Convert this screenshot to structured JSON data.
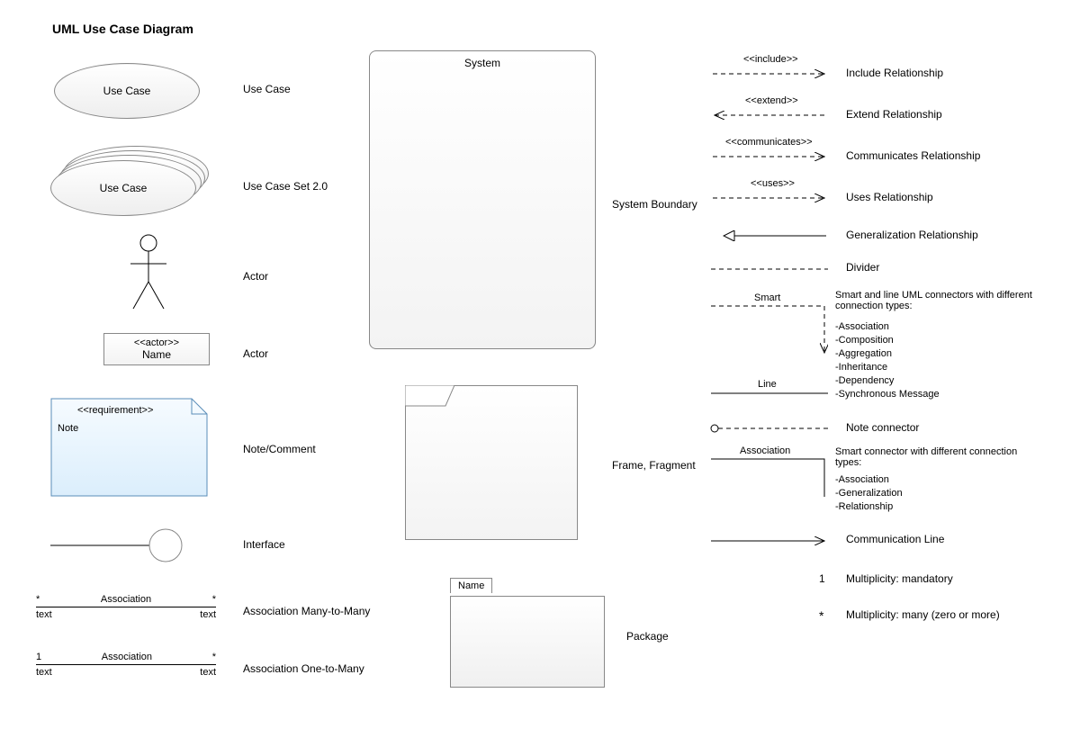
{
  "title": "UML Use Case Diagram",
  "left": {
    "useCase": {
      "shapeText": "Use Case",
      "label": "Use Case"
    },
    "useCaseSet": {
      "shapeText": "Use Case",
      "label": "Use Case Set 2.0"
    },
    "actorStick": {
      "label": "Actor"
    },
    "actorBox": {
      "stereo": "<<actor>>",
      "name": "Name",
      "label": "Actor"
    },
    "note": {
      "stereo": "<<requirement>>",
      "body": "Note",
      "label": "Note/Comment"
    },
    "interface": {
      "label": "Interface"
    },
    "assocMM": {
      "word": "Association",
      "starL": "*",
      "starR": "*",
      "textL": "text",
      "textR": "text",
      "label": "Association Many-to-Many"
    },
    "assocOM": {
      "word": "Association",
      "one": "1",
      "star": "*",
      "textL": "text",
      "textR": "text",
      "label": "Association One-to-Many"
    }
  },
  "center": {
    "system": {
      "title": "System",
      "label": "System Boundary"
    },
    "frame": {
      "label": "Frame, Fragment"
    },
    "package": {
      "name": "Name",
      "label": "Package"
    }
  },
  "right": {
    "include": {
      "text": "<<include>>",
      "label": "Include Relationship"
    },
    "extend": {
      "text": "<<extend>>",
      "label": "Extend Relationship"
    },
    "communicates": {
      "text": "<<communicates>>",
      "label": "Communicates Relationship"
    },
    "uses": {
      "text": "<<uses>>",
      "label": "Uses Relationship"
    },
    "generalization": {
      "label": "Generalization Relationship"
    },
    "divider": {
      "label": "Divider"
    },
    "smart": {
      "word": "Smart",
      "intro": "Smart and line UML connectors with different connection types:",
      "types": [
        "-Association",
        "-Composition",
        "-Aggregation",
        "-Inheritance",
        "-Dependency",
        "-Synchronous Message"
      ]
    },
    "line": {
      "word": "Line"
    },
    "noteConn": {
      "label": "Note connector"
    },
    "assocConn": {
      "word": "Association",
      "intro": "Smart connector with different connection types:",
      "types": [
        "-Association",
        "-Generalization",
        "-Relationship"
      ]
    },
    "commLine": {
      "label": "Communication Line"
    },
    "multMandatory": {
      "symbol": "1",
      "label": "Multiplicity: mandatory"
    },
    "multMany": {
      "symbol": "*",
      "label": "Multiplicity: many (zero or more)"
    }
  }
}
